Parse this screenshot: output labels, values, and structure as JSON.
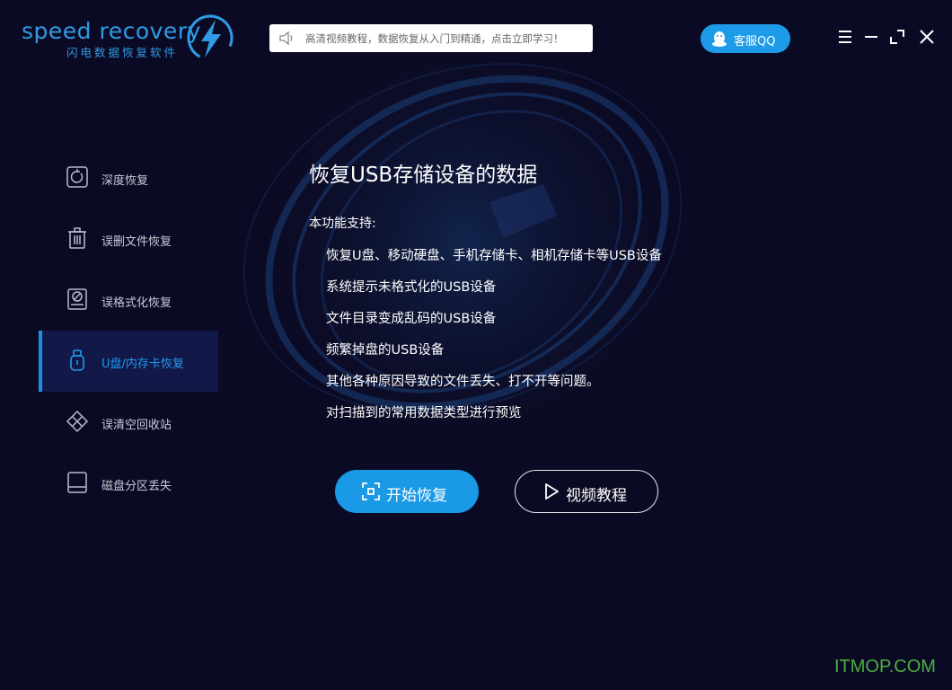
{
  "app": {
    "logo_text": "speed recovery",
    "logo_subtitle": "闪电数据恢复软件"
  },
  "header": {
    "notice_text": "高清视频教程，数据恢复从入门到精通，点击立即学习！",
    "notice_icon": "speaker-icon",
    "qq_label": "客服QQ",
    "qq_icon": "qq-penguin-icon",
    "window_controls": [
      "menu-icon",
      "minimize-icon",
      "restore-icon",
      "close-icon"
    ]
  },
  "sidebar": {
    "items": [
      {
        "label": "深度恢复",
        "icon": "deep-scan-icon",
        "active": false
      },
      {
        "label": "误删文件恢复",
        "icon": "trash-icon",
        "active": false
      },
      {
        "label": "误格式化恢复",
        "icon": "formatted-disk-icon",
        "active": false
      },
      {
        "label": "U盘/内存卡恢复",
        "icon": "usb-drive-icon",
        "active": true
      },
      {
        "label": "误清空回收站",
        "icon": "recycle-bin-icon",
        "active": false
      },
      {
        "label": "磁盘分区丢失",
        "icon": "partition-disk-icon",
        "active": false
      }
    ]
  },
  "main": {
    "title": "恢复USB存储设备的数据",
    "support_label": "本功能支持:",
    "features": [
      "恢复U盘、移动硬盘、手机存储卡、相机存储卡等USB设备",
      "系统提示未格式化的USB设备",
      "文件目录变成乱码的USB设备",
      "频繁掉盘的USB设备",
      "其他各种原因导致的文件丢失、打不开等问题。",
      "对扫描到的常用数据类型进行预览"
    ],
    "start_button": "开始恢复",
    "video_button": "视频教程"
  },
  "watermark": "ITMOP.COM",
  "colors": {
    "background": "#0b0a24",
    "accent": "#1999e6",
    "active_item_bg": "#121847",
    "watermark": "#4caf3f"
  }
}
